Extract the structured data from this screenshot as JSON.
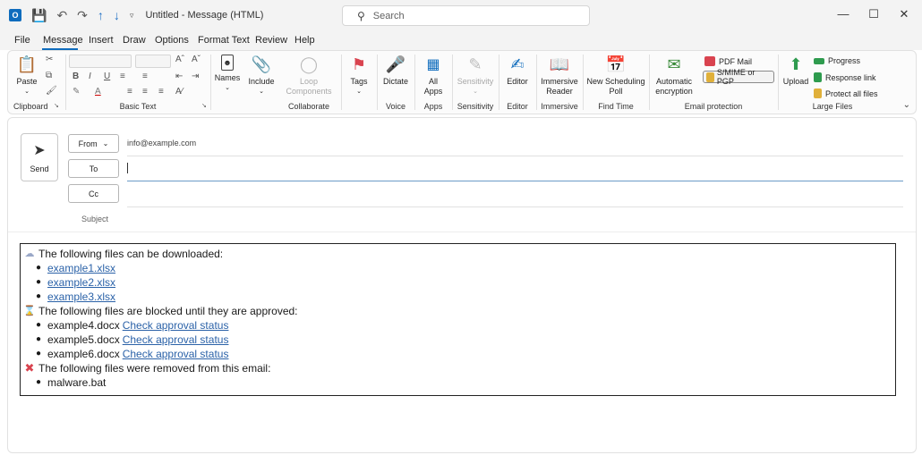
{
  "titlebar": {
    "title": "Untitled  -  Message (HTML)",
    "search_placeholder": "Search"
  },
  "menu": [
    "File",
    "Message",
    "Insert",
    "Draw",
    "Options",
    "Format Text",
    "Review",
    "Help"
  ],
  "ribbon": {
    "clipboard": {
      "paste": "Paste",
      "group": "Clipboard"
    },
    "basic_text": {
      "group": "Basic Text"
    },
    "names": "Names",
    "include": "Include",
    "loop": "Loop Components",
    "collaborate": "Collaborate",
    "tags": "Tags",
    "dictate": "Dictate",
    "voice": "Voice",
    "all_apps": "All Apps",
    "apps": "Apps",
    "sensitivity_btn": "Sensitivity",
    "sensitivity": "Sensitivity",
    "editor_btn": "Editor",
    "editor": "Editor",
    "immersive_btn": "Immersive Reader",
    "immersive": "Immersive",
    "new_poll": "New Scheduling Poll",
    "find_time": "Find Time",
    "auto_enc": "Automatic encryption",
    "pdf_mail": "PDF Mail",
    "smime": "S/MIME or PGP",
    "email_protection": "Email protection",
    "upload": "Upload",
    "progress": "Progress",
    "response_link": "Response link",
    "protect_all": "Protect all files",
    "large_files": "Large Files"
  },
  "compose": {
    "send": "Send",
    "from_label": "From",
    "from_value": "info@example.com",
    "to_label": "To",
    "cc_label": "Cc",
    "subject_label": "Subject"
  },
  "body": {
    "downloadable_heading": "The following files can be downloaded:",
    "downloadable": [
      "example1.xlsx",
      "example2.xlsx",
      "example3.xlsx"
    ],
    "blocked_heading": "The following files are blocked until they are approved:",
    "blocked": [
      "example4.docx",
      "example5.docx",
      "example6.docx"
    ],
    "check_status": "Check approval status",
    "removed_heading": "The following files were removed from this email:",
    "removed": [
      "malware.bat"
    ]
  },
  "colors": {
    "accent": "#0f6cbd",
    "link": "#2b62a8",
    "removed": "#d9434f"
  }
}
